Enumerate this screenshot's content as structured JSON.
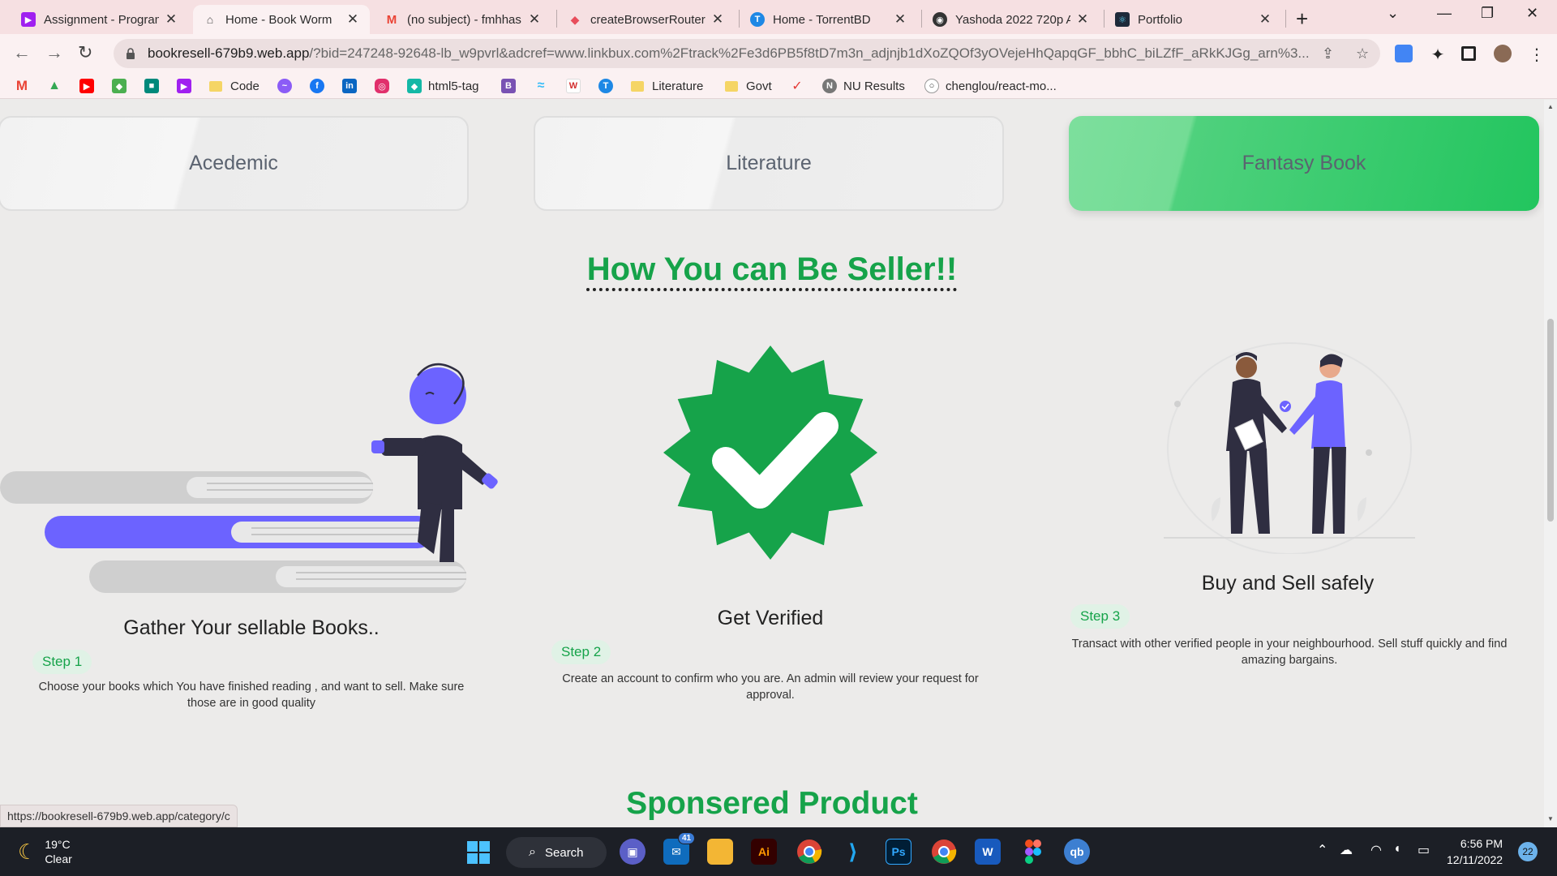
{
  "browser": {
    "tabs": [
      {
        "label": "Assignment - Program",
        "icon": "purple-play-icon",
        "color": "#a020f0",
        "active": false
      },
      {
        "label": "Home - Book Worm",
        "icon": "book-worm-icon",
        "color": "#777777",
        "active": true
      },
      {
        "label": "(no subject) - fmhhas",
        "icon": "gmail-icon",
        "color": "#ea4335",
        "active": false
      },
      {
        "label": "createBrowserRouter",
        "icon": "react-router-icon",
        "color": "#e84d5b",
        "active": false
      },
      {
        "label": "Home - TorrentBD",
        "icon": "torrentbd-icon",
        "color": "#1e88e5",
        "active": false
      },
      {
        "label": "Yashoda 2022 720p A",
        "icon": "globe-icon",
        "color": "#333333",
        "active": false
      },
      {
        "label": "Portfolio",
        "icon": "react-icon",
        "color": "#1e2a3a",
        "active": false
      }
    ],
    "address": {
      "host": "bookresell-679b9.web.app",
      "path": "/?bid=247248-92648-lb_w9pvrl&adcref=www.linkbux.com%2Ftrack%2Fe3d6PB5f8tD7m3n_adjnjb1dXoZQOf3yOVejeHhQapqGF_bbhC_biLZfF_aRkKJGg_arn%3..."
    },
    "bookmarks": [
      {
        "label": "",
        "icon": "gmail-icon",
        "color": "#ea4335"
      },
      {
        "label": "",
        "icon": "google-drive-icon",
        "color": "#34a853"
      },
      {
        "label": "",
        "icon": "youtube-icon",
        "color": "#ff0000"
      },
      {
        "label": "",
        "icon": "google-maps-icon",
        "color": "#4caf50"
      },
      {
        "label": "",
        "icon": "google-meet-icon",
        "color": "#00897b"
      },
      {
        "label": "",
        "icon": "purple-play-icon",
        "color": "#a020f0"
      },
      {
        "label": "Code",
        "icon": "folder-icon",
        "color": "#f5d565"
      },
      {
        "label": "",
        "icon": "messenger-icon",
        "color": "#8b5cf6"
      },
      {
        "label": "",
        "icon": "facebook-icon",
        "color": "#1877f2"
      },
      {
        "label": "",
        "icon": "linkedin-icon",
        "color": "#0a66c2"
      },
      {
        "label": "",
        "icon": "instagram-icon",
        "color": "#e1306c"
      },
      {
        "label": "html5-tag",
        "icon": "html5-tag-icon",
        "color": "#14b8a6"
      },
      {
        "label": "",
        "icon": "bootstrap-icon",
        "color": "#7952b3"
      },
      {
        "label": "",
        "icon": "tailwind-icon",
        "color": "#38bdf8"
      },
      {
        "label": "",
        "icon": "w-icon",
        "color": "#d32f2f"
      },
      {
        "label": "",
        "icon": "torrentbd-icon",
        "color": "#1e88e5"
      },
      {
        "label": "Literature",
        "icon": "folder-icon",
        "color": "#f5d565"
      },
      {
        "label": "Govt",
        "icon": "folder-icon",
        "color": "#f5d565"
      },
      {
        "label": "",
        "icon": "red-swoosh-icon",
        "color": "#e53935"
      },
      {
        "label": "NU Results",
        "icon": "nu-icon",
        "color": "#777777"
      },
      {
        "label": "chenglou/react-mo...",
        "icon": "github-icon",
        "color": "#333333"
      }
    ]
  },
  "page": {
    "categories": [
      {
        "label": "Acedemic",
        "active": false
      },
      {
        "label": "Literature",
        "active": false
      },
      {
        "label": "Fantasy Book",
        "active": true
      }
    ],
    "seller_title": "How You can Be Seller!!",
    "steps": [
      {
        "heading": "Gather Your sellable Books..",
        "badge": "Step 1",
        "desc": "Choose your books which You have finished reading , and want to sell. Make sure those are in good quality",
        "illustration": "person-climbing-books-illustration"
      },
      {
        "heading": "Get Verified",
        "badge": "Step 2",
        "desc": "Create an account to confirm who you are. An admin will review your request for approval.",
        "illustration": "verified-badge-icon"
      },
      {
        "heading": "Buy and Sell safely",
        "badge": "Step 3",
        "desc": "Transact with other verified people in your neighbourhood. Sell stuff quickly and find amazing bargains.",
        "illustration": "handshake-illustration"
      }
    ],
    "sponsored_title": "Sponsered Product",
    "status_url": "https://bookresell-679b9.web.app/category/c",
    "colors": {
      "accent": "#16a34a",
      "active_card": "#22c55e",
      "illustration": "#6c63ff"
    }
  },
  "taskbar": {
    "weather": {
      "temp": "19°C",
      "cond": "Clear"
    },
    "search_label": "Search",
    "mail_badge": "41",
    "clock_time": "6:56 PM",
    "clock_date": "12/11/2022",
    "notifications": "22",
    "apps": [
      "windows-start-icon",
      "search-icon",
      "teams-icon",
      "mail-icon",
      "file-explorer-icon",
      "illustrator-icon",
      "chrome-icon",
      "vscode-icon",
      "photoshop-icon",
      "chrome-profile-icon",
      "word-icon",
      "figma-icon",
      "qbittorrent-icon"
    ]
  }
}
